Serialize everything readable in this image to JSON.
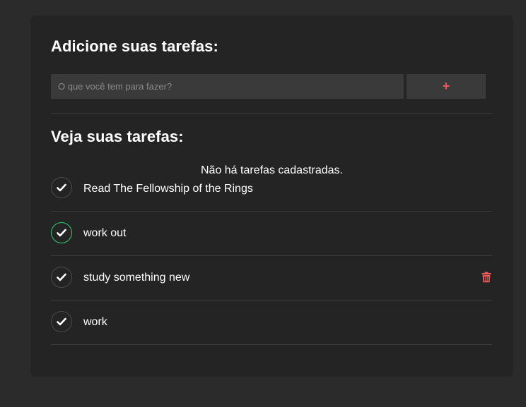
{
  "add_section": {
    "title": "Adicione suas tarefas:",
    "input_placeholder": "O que você tem para fazer?",
    "input_value": "",
    "add_button_label": "+"
  },
  "view_section": {
    "title": "Veja suas tarefas:",
    "empty_message": "Não há tarefas cadastradas."
  },
  "tasks": [
    {
      "text": "Read The Fellowship of the Rings",
      "completed": false
    },
    {
      "text": "work out",
      "completed": true
    },
    {
      "text": "study something new",
      "completed": false
    },
    {
      "text": "work",
      "completed": false
    }
  ],
  "icons": {
    "check": "check-icon",
    "trash": "trash-icon"
  },
  "colors": {
    "page_background": "#2b2b2b",
    "card_background": "#242424",
    "input_background": "#3a3a3a",
    "accent_red": "#e85a5a",
    "completed_green": "#2ecc71",
    "text": "#ffffff"
  }
}
